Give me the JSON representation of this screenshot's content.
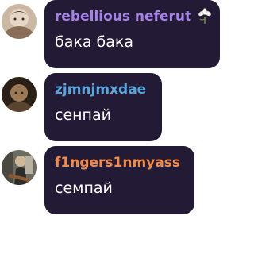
{
  "messages": [
    {
      "username": "rebellious neferut",
      "name_color": "#a582ea",
      "text": "бака бака",
      "badge_icon": "flower-icon"
    },
    {
      "username": "zjmnjmxdae",
      "name_color": "#5aa5de",
      "text": "сенпай"
    },
    {
      "username": "f1ngers1nmyass",
      "name_color": "#f08a4b",
      "text": "семпай"
    }
  ]
}
